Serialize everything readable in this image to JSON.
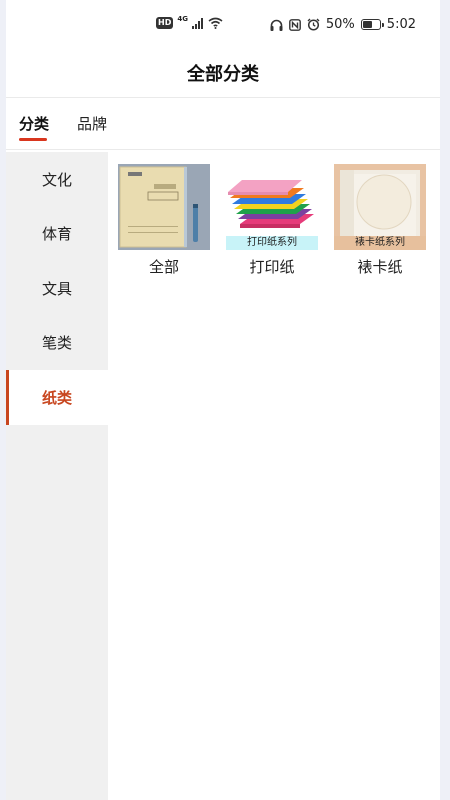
{
  "status_bar": {
    "hd": "HD",
    "network": "4G",
    "battery": "50%",
    "time": "5:02",
    "battery_level": 0.5
  },
  "header": {
    "title": "全部分类"
  },
  "tabs": [
    {
      "label": "分类",
      "active": true
    },
    {
      "label": "品牌",
      "active": false
    }
  ],
  "sidebar": {
    "items": [
      {
        "label": "文化",
        "active": false
      },
      {
        "label": "体育",
        "active": false
      },
      {
        "label": "文具",
        "active": false
      },
      {
        "label": "笔类",
        "active": false
      },
      {
        "label": "纸类",
        "active": true
      }
    ]
  },
  "grid": {
    "items": [
      {
        "label": "全部",
        "banner": ""
      },
      {
        "label": "打印纸",
        "banner": "打印纸系列"
      },
      {
        "label": "裱卡纸",
        "banner": "裱卡纸系列"
      }
    ]
  },
  "colors": {
    "accent": "#c8461f",
    "tab_indicator": "#d9361e",
    "sidebar_bg": "#f0f0f0"
  }
}
